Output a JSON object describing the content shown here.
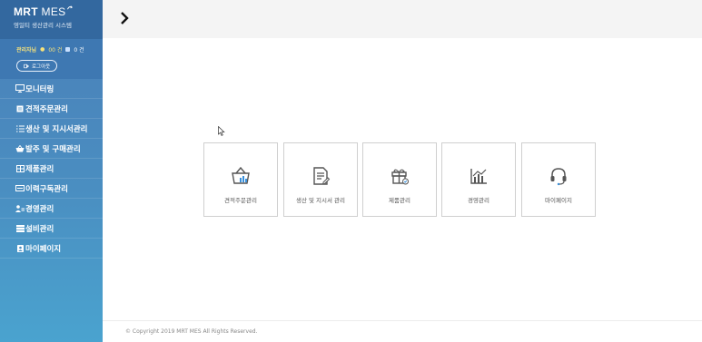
{
  "brand": {
    "title_bold": "MRT",
    "title_light": "MES",
    "subtitle": "영일티 생산관리 시스템"
  },
  "user": {
    "name": "관리자님",
    "flag1": "●",
    "flag1_text": "00 건",
    "flag2_text": "0 건",
    "logout": "로그아웃"
  },
  "menu": [
    {
      "icon": "monitor-icon",
      "label": "모니터링"
    },
    {
      "icon": "document-icon",
      "label": "견적주문관리"
    },
    {
      "icon": "list-icon",
      "label": "생산 및 지시서관리"
    },
    {
      "icon": "basket-icon",
      "label": "발주 및 구매관리"
    },
    {
      "icon": "grid-icon",
      "label": "제품관리"
    },
    {
      "icon": "card-icon",
      "label": "이력구독관리"
    },
    {
      "icon": "people-icon",
      "label": "경영관리"
    },
    {
      "icon": "server-icon",
      "label": "설비관리"
    },
    {
      "icon": "person-card-icon",
      "label": "마이페이지"
    }
  ],
  "cards": [
    {
      "icon": "basket-chart-icon",
      "label": "견적주문관리"
    },
    {
      "icon": "document-edit-icon",
      "label": "생산 및 지시서 관리"
    },
    {
      "icon": "gift-icon",
      "label": "제품관리"
    },
    {
      "icon": "bar-chart-icon",
      "label": "경영관리"
    },
    {
      "icon": "headset-icon",
      "label": "마이페이지"
    }
  ],
  "footer": {
    "copyright": "© Copyright 2019 MRT MES All Rights Reserved."
  },
  "colors": {
    "sidebar_top": "#33689f",
    "sidebar": "#4a8ec1",
    "accent_yellow": "#f6e27a"
  }
}
